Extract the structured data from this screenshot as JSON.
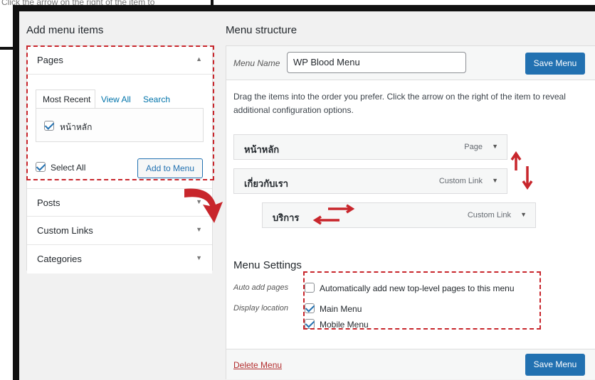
{
  "background": {
    "hint_text": "Click the arrow on the right of the item to"
  },
  "left": {
    "title": "Add menu items",
    "pages": {
      "label": "Pages",
      "tabs": [
        "Most Recent",
        "View All",
        "Search"
      ],
      "items": [
        {
          "label": "หน้าหลัก",
          "checked": true
        }
      ],
      "select_all_label": "Select All",
      "select_all_checked": true,
      "add_button": "Add to Menu"
    },
    "sections": [
      "Posts",
      "Custom Links",
      "Categories"
    ]
  },
  "right": {
    "title": "Menu structure",
    "menu_name_label": "Menu Name",
    "menu_name_value": "WP Blood Menu",
    "save_button": "Save Menu",
    "instructions": "Drag the items into the order you prefer. Click the arrow on the right of the item to reveal additional configuration options.",
    "items": [
      {
        "title": "หน้าหลัก",
        "type": "Page"
      },
      {
        "title": "เกี่ยวกับเรา",
        "type": "Custom Link"
      },
      {
        "title": "บริการ",
        "type": "Custom Link"
      }
    ],
    "settings": {
      "title": "Menu Settings",
      "auto_add_label": "Auto add pages",
      "auto_add_option": "Automatically add new top-level pages to this menu",
      "auto_add_checked": false,
      "display_location_label": "Display location",
      "locations": [
        {
          "label": "Main Menu",
          "checked": true
        },
        {
          "label": "Mobile Menu",
          "checked": true
        }
      ]
    },
    "delete_link": "Delete Menu",
    "save_button_bottom": "Save Menu"
  },
  "colors": {
    "annotation_red": "#c8262c",
    "primary_blue": "#2271b1",
    "link_blue": "#0073aa",
    "delete_red": "#b32d2e"
  }
}
